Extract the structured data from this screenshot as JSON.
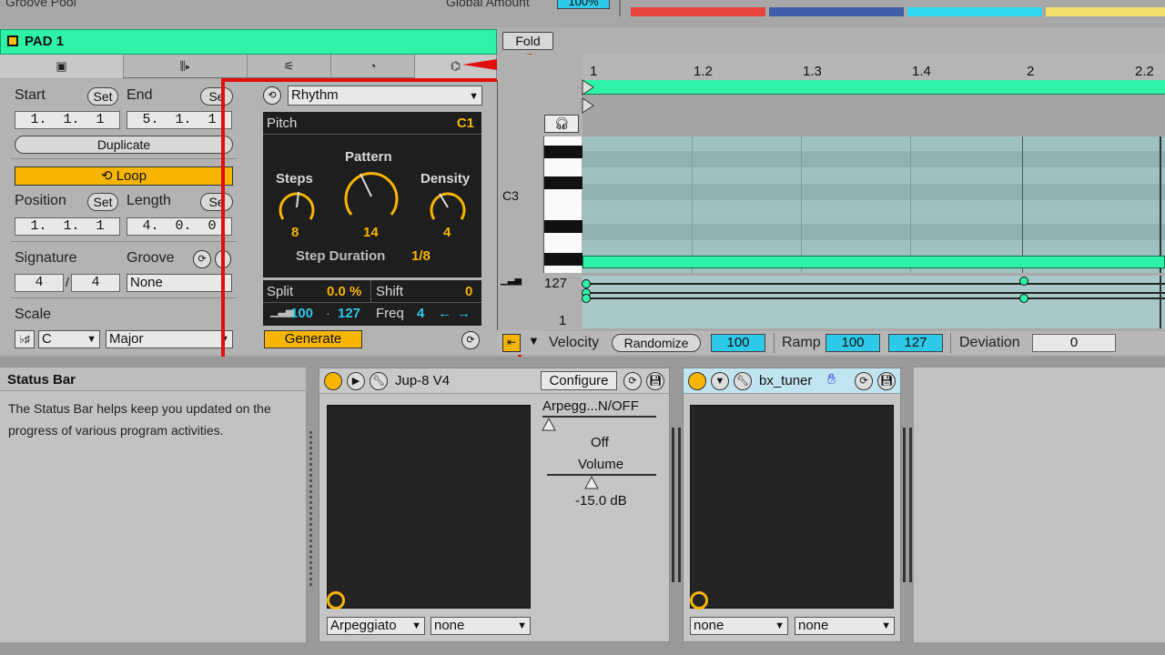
{
  "top": {
    "left_text": "Groove Pool",
    "amount_label": "Global Amount",
    "amount_value": "100%",
    "swatches": [
      "#e8433d",
      "#3e5fa8",
      "#2ed6f0",
      "#f2e06b"
    ]
  },
  "clip": {
    "name": "PAD 1",
    "fold": "Fold",
    "tabs": [
      "▣",
      "⫼▸",
      "⚟",
      "◔",
      "⌬"
    ],
    "start_label": "Start",
    "set": "Set",
    "end_label": "End",
    "set_cut": "Se",
    "start_value": "1.  1.  1",
    "end_value": "5.  1.  1",
    "duplicate": "Duplicate",
    "loop": "Loop",
    "position_label": "Position",
    "length_label": "Length",
    "position_value": "1.  1.  1",
    "length_value": "4.  0.  0",
    "signature_label": "Signature",
    "groove_label": "Groove",
    "sig_num": "4",
    "sig_slash": "/",
    "sig_den": "4",
    "groove_value": "None",
    "scale_label": "Scale",
    "scale_icon": "♭♯",
    "scale_root": "C",
    "scale_mode": "Major"
  },
  "generator": {
    "type": "Rhythm",
    "pitch_label": "Pitch",
    "pitch_value": "C1",
    "pattern_label": "Pattern",
    "pattern_value": "14",
    "steps_label": "Steps",
    "steps_value": "8",
    "density_label": "Density",
    "density_value": "4",
    "step_duration_label": "Step Duration",
    "step_duration_value": "1/8",
    "split_label": "Split",
    "split_value": "0.0 %",
    "shift_label": "Shift",
    "shift_value": "0",
    "vel_low": "100",
    "vel_sep": "·",
    "vel_high": "127",
    "freq_label": "Freq",
    "freq_value": "4",
    "generate": "Generate"
  },
  "ruler": {
    "ticks": [
      "1",
      "1.2",
      "1.3",
      "1.4",
      "2",
      "2.2"
    ]
  },
  "editor": {
    "c3_label": "C3",
    "vel_max": "127",
    "vel_min": "1"
  },
  "velocity_bar": {
    "label": "Velocity",
    "randomize": "Randomize",
    "velocity_value": "100",
    "ramp_label": "Ramp",
    "ramp_low": "100",
    "ramp_high": "127",
    "deviation_label": "Deviation",
    "deviation_value": "0"
  },
  "help": {
    "title": "Status Bar",
    "body": "The Status Bar helps keep you updated on the progress of various program activities."
  },
  "device1": {
    "name": "Jup-8 V4",
    "configure": "Configure",
    "param1": "Arpegg...N/OFF",
    "param1_value": "Off",
    "param2": "Volume",
    "param2_value": "-15.0 dB",
    "select1": "Arpeggiato",
    "select2": "none"
  },
  "device2": {
    "name": "bx_tuner",
    "select1": "none",
    "select2": "none"
  }
}
